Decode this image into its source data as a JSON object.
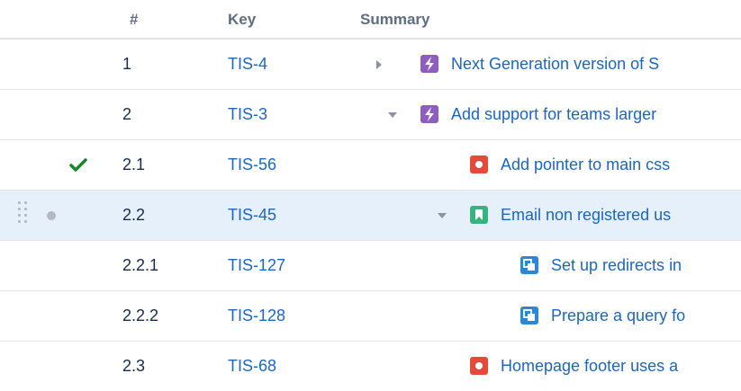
{
  "header": {
    "num_label": "#",
    "key_label": "Key",
    "summary_label": "Summary"
  },
  "rows": [
    {
      "num": "1",
      "key": "TIS-4",
      "summary": "Next Generation version of S",
      "icon": "epic-icon",
      "expand": "collapsed",
      "status": ""
    },
    {
      "num": "2",
      "key": "TIS-3",
      "summary": "Add support for teams larger",
      "icon": "epic-icon",
      "expand": "expanded",
      "status": ""
    },
    {
      "num": "2.1",
      "key": "TIS-56",
      "summary": "Add pointer to main css",
      "icon": "bug-icon",
      "expand": "none",
      "status": "done-check-icon"
    },
    {
      "num": "2.2",
      "key": "TIS-45",
      "summary": "Email non registered us",
      "icon": "story-icon",
      "expand": "expanded",
      "status": "in-progress-dot-icon",
      "selected": true
    },
    {
      "num": "2.2.1",
      "key": "TIS-127",
      "summary": "Set up redirects in",
      "icon": "subtask-icon",
      "expand": "none",
      "status": ""
    },
    {
      "num": "2.2.2",
      "key": "TIS-128",
      "summary": "Prepare a query fo",
      "icon": "subtask-icon",
      "expand": "none",
      "status": ""
    },
    {
      "num": "2.3",
      "key": "TIS-68",
      "summary": "Homepage footer uses a",
      "icon": "bug-icon",
      "expand": "none",
      "status": ""
    }
  ],
  "colors": {
    "link": "#1a66c7",
    "epic": "#8f5cbf",
    "bug": "#e5493a",
    "story": "#36b37e",
    "subtask": "#2b88d9",
    "done_check": "#14892c",
    "selected_row": "#e6f0fb"
  }
}
